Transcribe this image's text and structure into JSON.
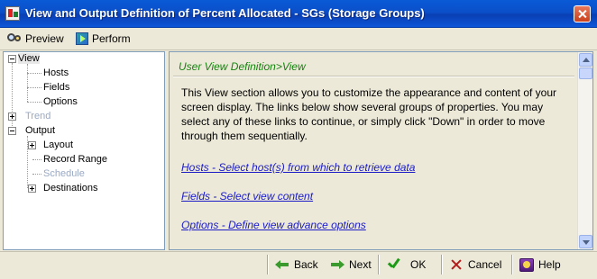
{
  "window": {
    "title": "View and Output Definition of Percent Allocated - SGs (Storage Groups)",
    "icons": {
      "app": "report-icon",
      "close": "close-icon"
    }
  },
  "toolbar": {
    "preview_label": "Preview",
    "perform_label": "Perform",
    "icons": {
      "preview": "binoculars-icon",
      "perform": "run-icon"
    }
  },
  "tree": {
    "items": [
      {
        "label": "View",
        "expanded": true,
        "selected": true
      },
      {
        "label": "Hosts"
      },
      {
        "label": "Fields"
      },
      {
        "label": "Options"
      },
      {
        "label": "Trend",
        "disabled": true,
        "collapsed": true
      },
      {
        "label": "Output",
        "expanded": true
      },
      {
        "label": "Layout",
        "collapsed": true
      },
      {
        "label": "Record Range"
      },
      {
        "label": "Schedule",
        "disabled": true
      },
      {
        "label": "Destinations",
        "collapsed": true
      }
    ]
  },
  "content": {
    "breadcrumb": "User View Definition>View",
    "description": "This View section allows you to customize the appearance and content of your screen display. The links below show several groups of properties. You may select any of these links to continue, or simply click \"Down\" in order to move through them sequentially.",
    "links": {
      "hosts": "Hosts - Select host(s) from which to retrieve data",
      "fields": "Fields - Select view content",
      "options": "Options - Define view advance options"
    }
  },
  "footer": {
    "back_label": "Back",
    "next_label": "Next",
    "ok_label": "OK",
    "cancel_label": "Cancel",
    "help_label": "Help",
    "icons": {
      "back": "back-arrow-icon",
      "next": "next-arrow-icon",
      "ok": "checkmark-icon",
      "cancel": "x-icon",
      "help": "help-book-icon"
    }
  },
  "colors": {
    "titlebar": "#0a5ad6",
    "breadcrumb": "#16820f",
    "link": "#1b1bc8",
    "disabled": "#9aa9c4"
  }
}
